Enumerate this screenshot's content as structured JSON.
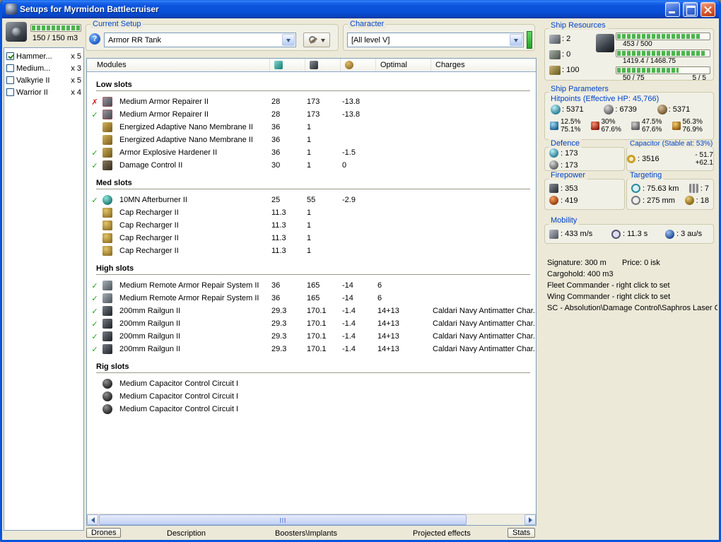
{
  "colors": {
    "accent_blue": "#0044cc",
    "titlebar_blue": "#0b52d8",
    "bar_green": "#4eb44e",
    "status_ok_green": "#1fa11f",
    "status_error_red": "#cc1f1f",
    "character_indicator_green": "#44c944"
  },
  "glyphs": {
    "check": "✓",
    "cross": "✗"
  },
  "window": {
    "title": "Setups for Myrmidon Battlecruiser"
  },
  "drone_bay": {
    "capacity": "150 / 150 m3",
    "capacity_pct": 100,
    "items": [
      {
        "name": "Hammer...",
        "qty": "x 5",
        "checked": true
      },
      {
        "name": "Medium...",
        "qty": "x 3",
        "checked": false
      },
      {
        "name": "Valkyrie II",
        "qty": "x 5",
        "checked": false
      },
      {
        "name": "Warrior II",
        "qty": "x 4",
        "checked": false
      }
    ]
  },
  "setup": {
    "label": "Current Setup",
    "selected": "Armor RR Tank"
  },
  "character": {
    "label": "Character",
    "selected": "[All level V]"
  },
  "modules": {
    "header": "Modules",
    "optimal_col": "Optimal",
    "charges_col": "Charges",
    "sections": [
      {
        "title": "Low slots",
        "rows": [
          {
            "status": "error",
            "icon": "armor-repairer",
            "name": "Medium Armor Repairer II",
            "cpu": "28",
            "pg": "173",
            "cap": "-13.8",
            "optimal": "",
            "charges": ""
          },
          {
            "status": "ok",
            "icon": "armor-repairer",
            "name": "Medium Armor Repairer II",
            "cpu": "28",
            "pg": "173",
            "cap": "-13.8",
            "optimal": "",
            "charges": ""
          },
          {
            "status": "",
            "icon": "nano-membrane",
            "name": "Energized Adaptive Nano Membrane II",
            "cpu": "36",
            "pg": "1",
            "cap": "",
            "optimal": "",
            "charges": ""
          },
          {
            "status": "",
            "icon": "nano-membrane",
            "name": "Energized Adaptive Nano Membrane II",
            "cpu": "36",
            "pg": "1",
            "cap": "",
            "optimal": "",
            "charges": ""
          },
          {
            "status": "ok",
            "icon": "armor-hardener",
            "name": "Armor Explosive Hardener II",
            "cpu": "36",
            "pg": "1",
            "cap": "-1.5",
            "optimal": "",
            "charges": ""
          },
          {
            "status": "ok",
            "icon": "damage-control",
            "name": "Damage Control II",
            "cpu": "30",
            "pg": "1",
            "cap": "0",
            "optimal": "",
            "charges": ""
          }
        ]
      },
      {
        "title": "Med slots",
        "rows": [
          {
            "status": "ok",
            "icon": "afterburner",
            "name": "10MN Afterburner II",
            "cpu": "25",
            "pg": "55",
            "cap": "-2.9",
            "optimal": "",
            "charges": ""
          },
          {
            "status": "",
            "icon": "cap-recharger",
            "name": "Cap Recharger II",
            "cpu": "11.3",
            "pg": "1",
            "cap": "",
            "optimal": "",
            "charges": ""
          },
          {
            "status": "",
            "icon": "cap-recharger",
            "name": "Cap Recharger II",
            "cpu": "11.3",
            "pg": "1",
            "cap": "",
            "optimal": "",
            "charges": ""
          },
          {
            "status": "",
            "icon": "cap-recharger",
            "name": "Cap Recharger II",
            "cpu": "11.3",
            "pg": "1",
            "cap": "",
            "optimal": "",
            "charges": ""
          },
          {
            "status": "",
            "icon": "cap-recharger",
            "name": "Cap Recharger II",
            "cpu": "11.3",
            "pg": "1",
            "cap": "",
            "optimal": "",
            "charges": ""
          }
        ]
      },
      {
        "title": "High slots",
        "rows": [
          {
            "status": "ok",
            "icon": "remote-armor-repairer",
            "name": "Medium Remote Armor Repair System II",
            "cpu": "36",
            "pg": "165",
            "cap": "-14",
            "optimal": "6",
            "charges": ""
          },
          {
            "status": "ok",
            "icon": "remote-armor-repairer",
            "name": "Medium Remote Armor Repair System II",
            "cpu": "36",
            "pg": "165",
            "cap": "-14",
            "optimal": "6",
            "charges": ""
          },
          {
            "status": "ok",
            "icon": "railgun",
            "name": "200mm Railgun II",
            "cpu": "29.3",
            "pg": "170.1",
            "cap": "-1.4",
            "optimal": "14+13",
            "charges": "Caldari Navy Antimatter Char..."
          },
          {
            "status": "ok",
            "icon": "railgun",
            "name": "200mm Railgun II",
            "cpu": "29.3",
            "pg": "170.1",
            "cap": "-1.4",
            "optimal": "14+13",
            "charges": "Caldari Navy Antimatter Char..."
          },
          {
            "status": "ok",
            "icon": "railgun",
            "name": "200mm Railgun II",
            "cpu": "29.3",
            "pg": "170.1",
            "cap": "-1.4",
            "optimal": "14+13",
            "charges": "Caldari Navy Antimatter Char..."
          },
          {
            "status": "ok",
            "icon": "railgun",
            "name": "200mm Railgun II",
            "cpu": "29.3",
            "pg": "170.1",
            "cap": "-1.4",
            "optimal": "14+13",
            "charges": "Caldari Navy Antimatter Char..."
          }
        ]
      },
      {
        "title": "Rig slots",
        "rows": [
          {
            "status": "",
            "icon": "rig-circuit",
            "name": "Medium Capacitor Control Circuit I",
            "cpu": "",
            "pg": "",
            "cap": "",
            "optimal": "",
            "charges": ""
          },
          {
            "status": "",
            "icon": "rig-circuit",
            "name": "Medium Capacitor Control Circuit I",
            "cpu": "",
            "pg": "",
            "cap": "",
            "optimal": "",
            "charges": ""
          },
          {
            "status": "",
            "icon": "rig-circuit",
            "name": "Medium Capacitor Control Circuit I",
            "cpu": "",
            "pg": "",
            "cap": "",
            "optimal": "",
            "charges": ""
          }
        ]
      }
    ]
  },
  "tabs": [
    {
      "label": "Drones",
      "boxed": true
    },
    {
      "label": "Description",
      "boxed": false
    },
    {
      "label": "Boosters\\Implants",
      "boxed": false
    },
    {
      "label": "Projected effects",
      "boxed": false
    },
    {
      "label": "Stats",
      "boxed": true
    }
  ],
  "ship_resources": {
    "label": "Ship Resources",
    "slots": [
      {
        "icon": "turret-hardpoint",
        "value": "2"
      },
      {
        "icon": "launcher-hardpoint",
        "value": "0"
      },
      {
        "icon": "calibration",
        "value": "100"
      }
    ],
    "cpu": {
      "text": "453 / 500",
      "pct": 90.6
    },
    "powergrid": {
      "text": "1419.4 / 1468.75",
      "pct": 96.6
    },
    "calibration": {
      "text": "50 / 75",
      "pct": 66.7
    },
    "slots_used": "5 / 5"
  },
  "ship_parameters": {
    "label": "Ship Parameters",
    "hitpoints": {
      "title": "Hitpoints (Effective HP: 45,766)",
      "shield": "5371",
      "armor": "6739",
      "structure": "5371",
      "resists": [
        {
          "type": "em",
          "shield": "12.5%",
          "armor": "75.1%"
        },
        {
          "type": "explosive",
          "shield": "30%",
          "armor": "67.6%"
        },
        {
          "type": "kinetic",
          "shield": "47.5%",
          "armor": "67.6%"
        },
        {
          "type": "thermal",
          "shield": "56.3%",
          "armor": "76.9%"
        }
      ]
    },
    "defence": {
      "label": "Defence",
      "shield_value": "173",
      "armor_value": "173"
    },
    "capacitor": {
      "label": "Capacitor (Stable at: 53%)",
      "amount": "3516",
      "usage": "- 51.7",
      "recharge": "+62.1"
    },
    "firepower": {
      "label": "Firepower",
      "volley": "353",
      "dps": "419"
    },
    "targeting": {
      "label": "Targeting",
      "range": "75.63 km",
      "max_targets": "7",
      "scan_resolution": "275 mm",
      "sensor_strength": "18"
    },
    "mobility": {
      "label": "Mobility",
      "speed": "433 m/s",
      "align_time": "11.3 s",
      "warp_speed": "3 au/s"
    }
  },
  "footer_info": {
    "signature": "Signature: 300 m",
    "price": "Price: 0 isk",
    "cargohold": "Cargohold: 400 m3",
    "fleet": "Fleet Commander - right click to set",
    "wing": "Wing Commander - right click to set",
    "sc": "SC - Absolution\\Damage Control\\Saphros Laser C"
  }
}
